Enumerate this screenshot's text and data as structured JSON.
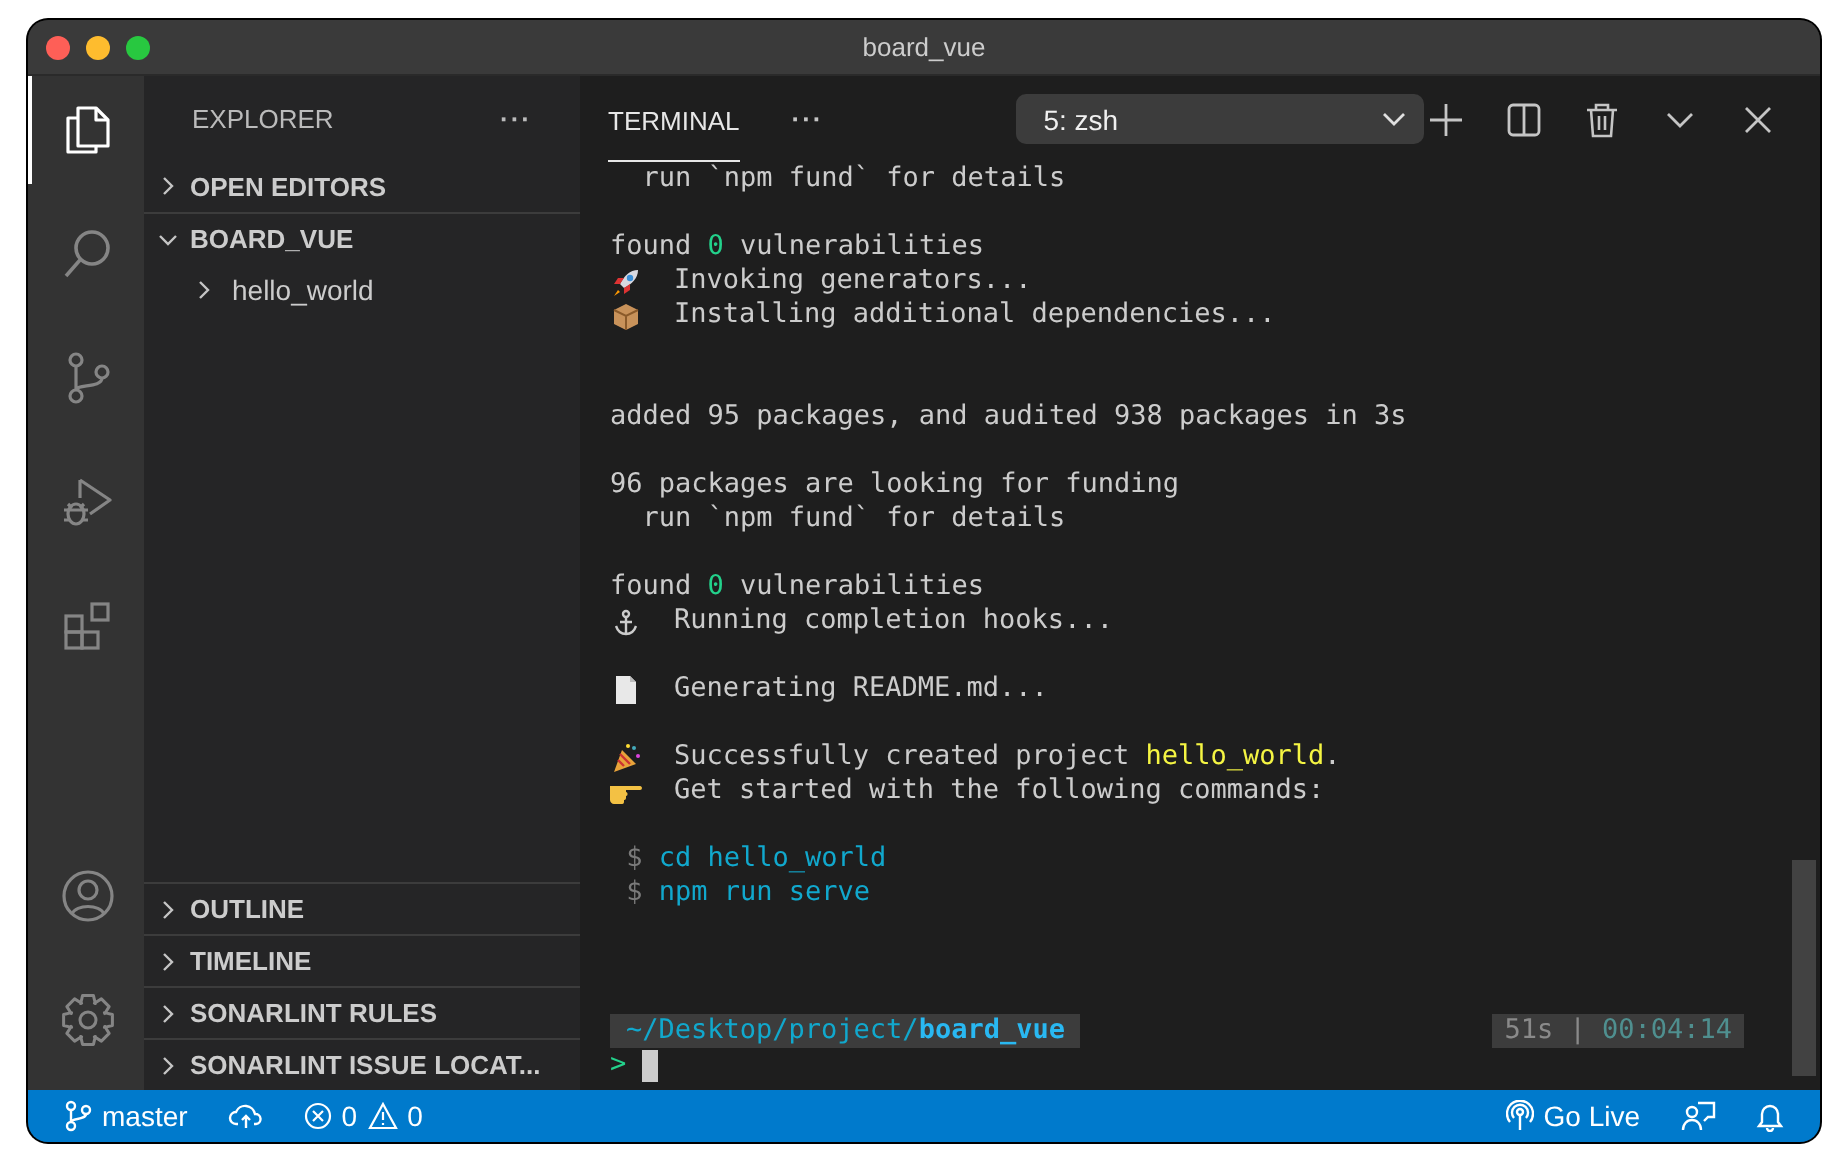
{
  "window": {
    "title": "board_vue"
  },
  "activity_bar": {
    "top": [
      {
        "kind": "files",
        "selected": true
      },
      {
        "kind": "search",
        "selected": false
      },
      {
        "kind": "source-control",
        "selected": false
      },
      {
        "kind": "run-debug",
        "selected": false
      },
      {
        "kind": "extensions",
        "selected": false
      }
    ],
    "bottom": [
      {
        "kind": "account",
        "selected": false
      },
      {
        "kind": "settings",
        "selected": false
      }
    ]
  },
  "sidebar": {
    "title": "EXPLORER",
    "more": "···",
    "sections": [
      {
        "label": "OPEN EDITORS",
        "expanded": false
      },
      {
        "label": "BOARD_VUE",
        "expanded": true,
        "children": [
          {
            "label": "hello_world",
            "expanded": false
          }
        ]
      }
    ],
    "bottom_sections": [
      {
        "label": "OUTLINE",
        "expanded": false
      },
      {
        "label": "TIMELINE",
        "expanded": false
      },
      {
        "label": "SONARLINT RULES",
        "expanded": false
      },
      {
        "label": "SONARLINT ISSUE LOCAT...",
        "expanded": false
      }
    ]
  },
  "panel": {
    "tabs": [
      {
        "label": "TERMINAL",
        "selected": true
      }
    ],
    "more": "···",
    "terminal_select": "5: zsh",
    "actions": [
      {
        "kind": "plus"
      },
      {
        "kind": "split"
      },
      {
        "kind": "trash"
      },
      {
        "kind": "chevron"
      },
      {
        "kind": "close"
      }
    ],
    "lines": [
      {
        "kind": "plain",
        "segments": [
          {
            "text": "  run `npm fund` for details",
            "kind": "plain"
          }
        ]
      },
      {
        "kind": "blank"
      },
      {
        "kind": "plain",
        "segments": [
          {
            "text": "found ",
            "kind": "plain"
          },
          {
            "text": "0",
            "kind": "green"
          },
          {
            "text": " vulnerabilities",
            "kind": "plain"
          }
        ]
      },
      {
        "kind": "rocket",
        "segments": [
          {
            "text": "Invoking generators...",
            "kind": "plain"
          }
        ]
      },
      {
        "kind": "package",
        "segments": [
          {
            "text": "Installing additional dependencies...",
            "kind": "plain"
          }
        ]
      },
      {
        "kind": "blank"
      },
      {
        "kind": "blank"
      },
      {
        "kind": "plain",
        "segments": [
          {
            "text": "added 95 packages, and audited 938 packages in 3s",
            "kind": "plain"
          }
        ]
      },
      {
        "kind": "blank"
      },
      {
        "kind": "plain",
        "segments": [
          {
            "text": "96 packages are looking for funding",
            "kind": "plain"
          }
        ]
      },
      {
        "kind": "plain",
        "segments": [
          {
            "text": "  run `npm fund` for details",
            "kind": "plain"
          }
        ]
      },
      {
        "kind": "blank"
      },
      {
        "kind": "plain",
        "segments": [
          {
            "text": "found ",
            "kind": "plain"
          },
          {
            "text": "0",
            "kind": "green"
          },
          {
            "text": " vulnerabilities",
            "kind": "plain"
          }
        ]
      },
      {
        "kind": "anchor",
        "segments": [
          {
            "text": "Running completion hooks...",
            "kind": "plain"
          }
        ]
      },
      {
        "kind": "blank"
      },
      {
        "kind": "document",
        "segments": [
          {
            "text": "Generating README.md...",
            "kind": "plain"
          }
        ]
      },
      {
        "kind": "blank"
      },
      {
        "kind": "party",
        "segments": [
          {
            "text": "Successfully created project ",
            "kind": "plain"
          },
          {
            "text": "hello_world",
            "kind": "yellow"
          },
          {
            "text": ".",
            "kind": "plain"
          }
        ]
      },
      {
        "kind": "pointing",
        "segments": [
          {
            "text": "Get started with the following commands:",
            "kind": "plain"
          }
        ]
      },
      {
        "kind": "blank"
      },
      {
        "kind": "plain",
        "segments": [
          {
            "text": " $ ",
            "kind": "dim"
          },
          {
            "text": "cd hello_world",
            "kind": "cyan"
          }
        ]
      },
      {
        "kind": "plain",
        "segments": [
          {
            "text": " $ ",
            "kind": "dim"
          },
          {
            "text": "npm run serve",
            "kind": "cyan"
          }
        ]
      }
    ],
    "prompt": {
      "path": "~/Desktop/project/",
      "folder": "board_vue",
      "duration": "51s",
      "separator": "|",
      "clock": "00:04:14",
      "symbol": ">"
    }
  },
  "status_bar": {
    "left": [
      {
        "kind": "branch",
        "text": "master"
      },
      {
        "kind": "sync"
      },
      {
        "kind": "problems",
        "errors": "0",
        "warnings": "0"
      }
    ],
    "right": [
      {
        "kind": "go-live",
        "text": "Go Live"
      },
      {
        "kind": "feedback"
      },
      {
        "kind": "bell"
      }
    ]
  }
}
